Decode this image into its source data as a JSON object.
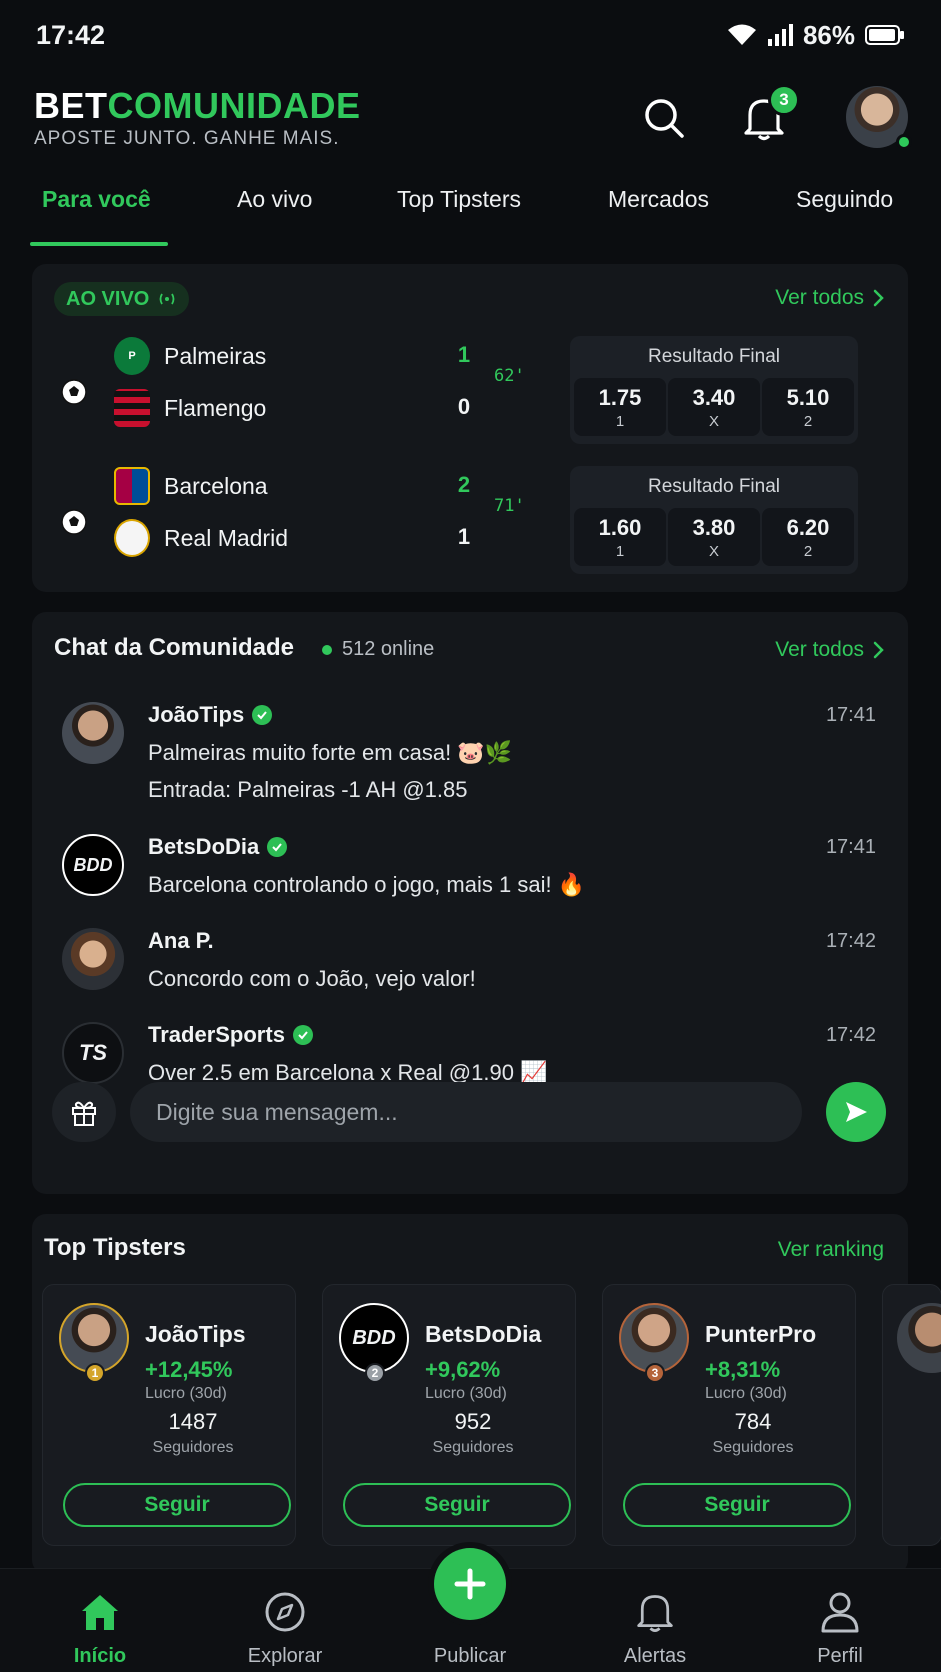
{
  "status_bar": {
    "time": "17:42",
    "battery": "86%"
  },
  "header": {
    "logo_part1": "BET",
    "logo_part2": "COMUNIDADE",
    "tagline": "APOSTE JUNTO. GANHE MAIS.",
    "notifications_count": "3"
  },
  "tabs": [
    "Para você",
    "Ao vivo",
    "Top Tipsters",
    "Mercados",
    "Seguindo"
  ],
  "live": {
    "badge": "AO VIVO",
    "see_all": "Ver todos",
    "matches": [
      {
        "home": "Palmeiras",
        "away": "Flamengo",
        "home_score": "1",
        "away_score": "0",
        "minute": "62'",
        "market": "Resultado Final",
        "odds": [
          {
            "value": "1.75",
            "label": "1"
          },
          {
            "value": "3.40",
            "label": "X"
          },
          {
            "value": "5.10",
            "label": "2"
          }
        ]
      },
      {
        "home": "Barcelona",
        "away": "Real Madrid",
        "home_score": "2",
        "away_score": "1",
        "minute": "71'",
        "market": "Resultado Final",
        "odds": [
          {
            "value": "1.60",
            "label": "1"
          },
          {
            "value": "3.80",
            "label": "X"
          },
          {
            "value": "6.20",
            "label": "2"
          }
        ]
      }
    ]
  },
  "chat": {
    "title": "Chat da Comunidade",
    "online": "512 online",
    "see_all": "Ver todos",
    "messages": [
      {
        "user": "JoãoTips",
        "time": "17:41",
        "line1": "Palmeiras muito forte em casa! 🐷🌿",
        "line2": "Entrada: Palmeiras -1 AH @1.85"
      },
      {
        "user": "BetsDoDia",
        "time": "17:41",
        "line1": "Barcelona controlando o jogo, mais 1 sai! 🔥",
        "avatar_text": "BDD"
      },
      {
        "user": "Ana P.",
        "time": "17:42",
        "line1": "Concordo com o João, vejo valor!"
      },
      {
        "user": "TraderSports",
        "time": "17:42",
        "line1": "Over 2.5 em Barcelona x Real @1.90 📈",
        "avatar_text": "TS"
      }
    ],
    "input_placeholder": "Digite sua mensagem..."
  },
  "tipsters": {
    "title": "Top Tipsters",
    "see_ranking": "Ver ranking",
    "items": [
      {
        "name": "JoãoTips",
        "rank": "1",
        "profit": "+12,45%",
        "profit_label": "Lucro (30d)",
        "followers": "1487",
        "followers_label": "Seguidores",
        "button": "Seguir"
      },
      {
        "name": "BetsDoDia",
        "rank": "2",
        "profit": "+9,62%",
        "profit_label": "Lucro (30d)",
        "followers": "952",
        "followers_label": "Seguidores",
        "button": "Seguir",
        "avatar_text": "BDD"
      },
      {
        "name": "PunterPro",
        "rank": "3",
        "profit": "+8,31%",
        "profit_label": "Lucro (30d)",
        "followers": "784",
        "followers_label": "Seguidores",
        "button": "Seguir"
      }
    ]
  },
  "bottom_nav": [
    "Início",
    "Explorar",
    "Publicar",
    "Alertas",
    "Perfil"
  ],
  "colors": {
    "accent": "#31c85c",
    "background": "#0b0d10",
    "card": "#14171b"
  }
}
